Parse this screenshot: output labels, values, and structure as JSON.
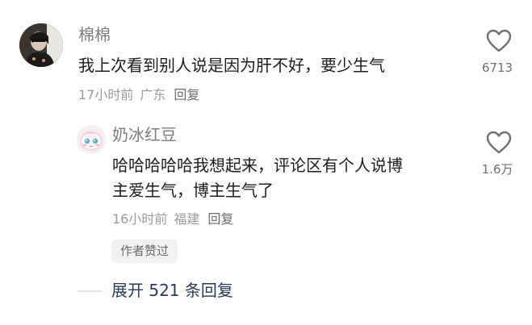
{
  "comment": {
    "username": "棉棉",
    "text": "我上次看到别人说是因为肝不好，要少生气",
    "time": "17小时前",
    "location": "广东",
    "reply_label": "回复",
    "like_count": "6713"
  },
  "reply": {
    "username": "奶冰红豆",
    "text_line1": "哈哈哈哈哈我想起来，评论区有个人说博",
    "text_line2": "主爱生气，博主生气了",
    "time": "16小时前",
    "location": "福建",
    "reply_label": "回复",
    "like_count": "1.6万",
    "author_badge": "作者赞过"
  },
  "expand": {
    "label": "展开 521 条回复"
  },
  "icons": {
    "like": "heart-outline-icon"
  },
  "colors": {
    "username": "#7d7d7d",
    "content": "#1c1c1c",
    "meta": "#9a9a9a",
    "expand": "#2b3a5c"
  }
}
